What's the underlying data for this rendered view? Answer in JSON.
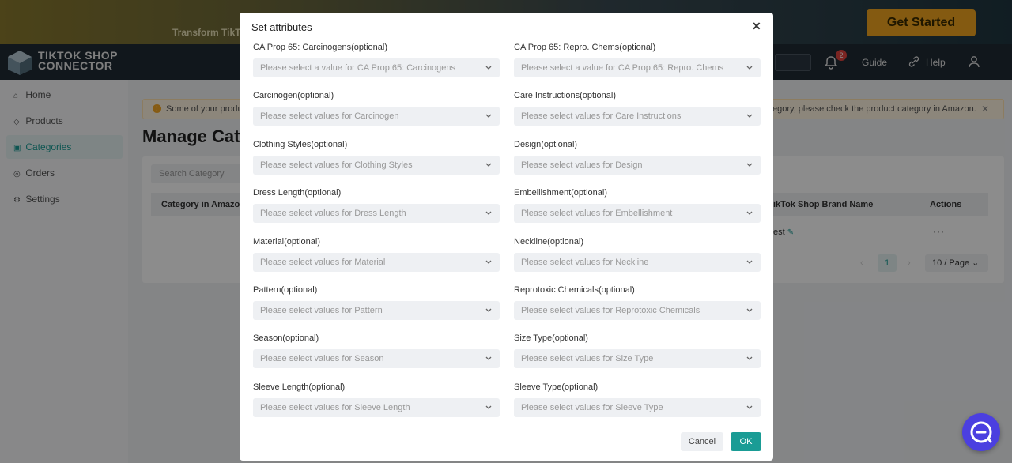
{
  "banner": {
    "text": "Transform TikTo",
    "cta": "Get Started"
  },
  "topbar": {
    "logo_line1": "TIKTOK SHOP",
    "logo_line2": "CONNECTOR",
    "notifications_count": "2",
    "guide": "Guide",
    "help": "Help"
  },
  "sidebar": {
    "items": [
      {
        "label": "Home",
        "icon": "home-icon"
      },
      {
        "label": "Products",
        "icon": "tag-icon"
      },
      {
        "label": "Categories",
        "icon": "category-icon"
      },
      {
        "label": "Orders",
        "icon": "orders-icon"
      },
      {
        "label": "Settings",
        "icon": "gear-icon"
      }
    ]
  },
  "page": {
    "alert_left": "Some of your produ",
    "alert_right": "egory, please check the product category in Amazon.",
    "title": "Manage Cate",
    "search_placeholder": "Search Category",
    "table": {
      "col_category": "Category in Amazon",
      "col_brand": "ikTok Shop Brand Name",
      "col_actions": "Actions",
      "row_value": "est"
    },
    "pagination": {
      "current": "1",
      "page_size": "10  / Page"
    }
  },
  "modal": {
    "title": "Set attributes",
    "fields": [
      {
        "label": "CA Prop 65: Carcinogens(optional)",
        "placeholder": "Please select a value for CA Prop 65: Carcinogens"
      },
      {
        "label": "CA Prop 65: Repro. Chems(optional)",
        "placeholder": "Please select a value for CA Prop 65: Repro. Chems"
      },
      {
        "label": "Carcinogen(optional)",
        "placeholder": "Please select values for Carcinogen"
      },
      {
        "label": "Care Instructions(optional)",
        "placeholder": "Please select values for Care Instructions"
      },
      {
        "label": "Clothing Styles(optional)",
        "placeholder": "Please select values for Clothing Styles"
      },
      {
        "label": "Design(optional)",
        "placeholder": "Please select values for Design"
      },
      {
        "label": "Dress Length(optional)",
        "placeholder": "Please select values for Dress Length"
      },
      {
        "label": "Embellishment(optional)",
        "placeholder": "Please select values for Embellishment"
      },
      {
        "label": "Material(optional)",
        "placeholder": "Please select values for Material"
      },
      {
        "label": "Neckline(optional)",
        "placeholder": "Please select values for Neckline"
      },
      {
        "label": "Pattern(optional)",
        "placeholder": "Please select values for Pattern"
      },
      {
        "label": "Reprotoxic Chemicals(optional)",
        "placeholder": "Please select values for Reprotoxic Chemicals"
      },
      {
        "label": "Season(optional)",
        "placeholder": "Please select values for Season"
      },
      {
        "label": "Size Type(optional)",
        "placeholder": "Please select values for Size Type"
      },
      {
        "label": "Sleeve Length(optional)",
        "placeholder": "Please select values for Sleeve Length"
      },
      {
        "label": "Sleeve Type(optional)",
        "placeholder": "Please select values for Sleeve Type"
      }
    ],
    "cancel": "Cancel",
    "ok": "OK"
  },
  "colors": {
    "accent": "#1a9c95",
    "banner_cta": "#f0a51f",
    "chat": "#4b3fe0"
  }
}
